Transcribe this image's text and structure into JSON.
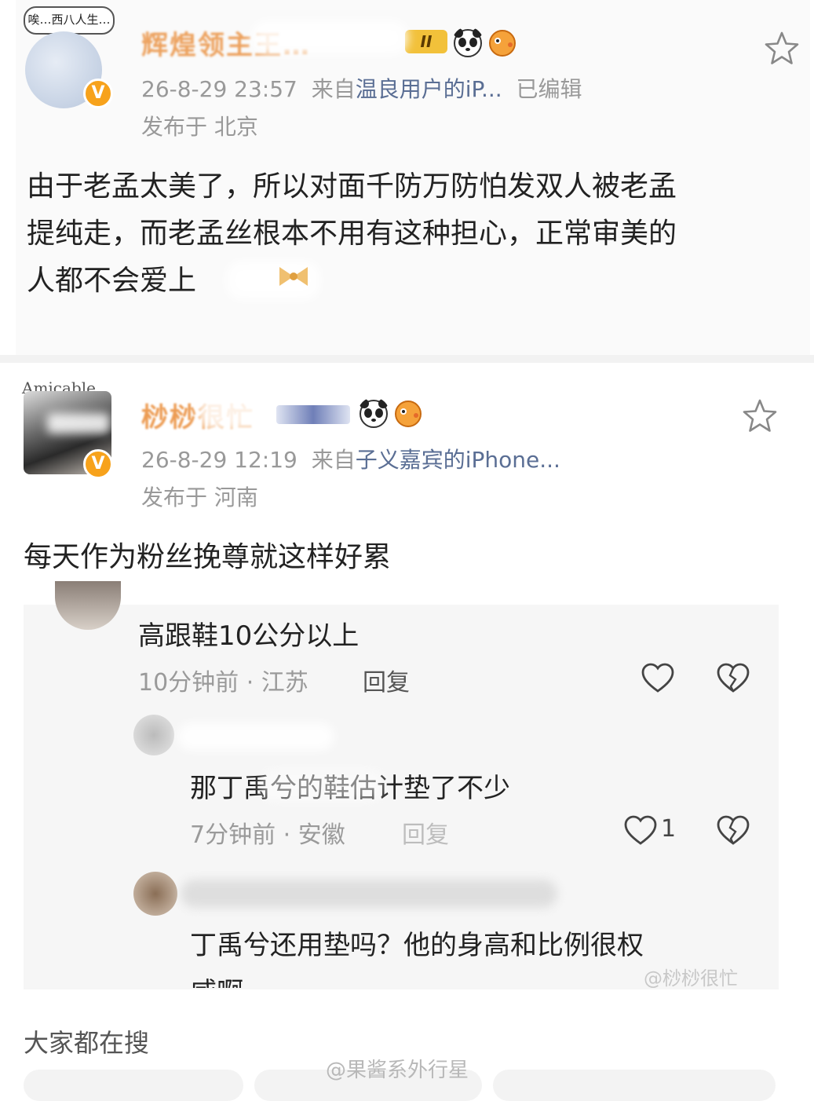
{
  "post1": {
    "avatar_bubble_text": "唉…西八人生…",
    "username": "辉煌领主王…",
    "badge_text": "II",
    "timestamp": "26-8-29 23:57",
    "source_prefix": "来自",
    "source_device": "温良用户的iP...",
    "edited": "已编辑",
    "location": "发布于 北京",
    "body_lines": [
      "由于老孟太美了，所以对面千防万防怕发双人被老孟",
      "提纯走，而老孟丝根本不用有这种担心，正常审美的",
      "人都不会爱上"
    ]
  },
  "post2": {
    "avatar_caption": "Amicable",
    "username": "桫桫很忙",
    "timestamp": "26-8-29 12:19",
    "source_prefix": "来自",
    "source_device": "子义嘉宾的iPhone...",
    "location": "发布于 河南",
    "body": "每天作为粉丝挽尊就这样好累"
  },
  "comments": [
    {
      "text": "高跟鞋10公分以上",
      "meta": "10分钟前 · 江苏",
      "reply_label": "回复",
      "like_count": ""
    },
    {
      "text": "那丁禹兮的鞋估计垫了不少",
      "meta": "7分钟前 · 安徽",
      "reply_label": "回复",
      "like_count": "1"
    },
    {
      "text_lines": [
        "丁禹兮还用垫吗？他的身高和比例很权",
        "威啊"
      ]
    }
  ],
  "watermark_comment": "@桫桫很忙",
  "section_title": "大家都在搜",
  "watermark_footer": "@果酱系外行星",
  "colors": {
    "vip_orange": "#f7a21b",
    "username_orange": "#e8842a",
    "source_blue": "#5a6e94",
    "meta_gray": "#999999"
  },
  "icons": [
    "star-icon",
    "heart-icon",
    "broken-heart-icon",
    "verified-badge-icon",
    "panda-emoji-icon",
    "puffer-emoji-icon"
  ]
}
